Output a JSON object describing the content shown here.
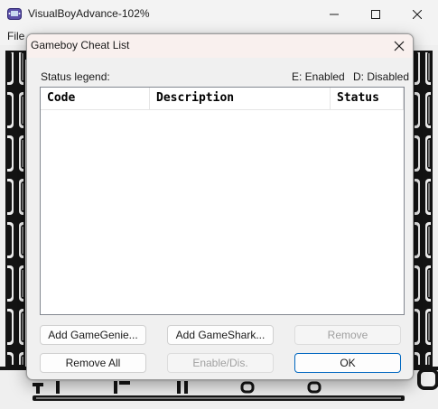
{
  "window": {
    "title": "VisualBoyAdvance-102%",
    "controls": [
      "minimize",
      "maximize",
      "close"
    ]
  },
  "menubar": {
    "items": [
      "File"
    ]
  },
  "dialog": {
    "title": "Gameboy Cheat List",
    "status_legend_label": "Status legend:",
    "legend_enabled": "E: Enabled",
    "legend_disabled": "D: Disabled",
    "columns": [
      "Code",
      "Description",
      "Status"
    ],
    "rows": [],
    "buttons": {
      "add_gamegenie": "Add GameGenie...",
      "add_gameshark": "Add GameShark...",
      "remove": "Remove",
      "remove_all": "Remove All",
      "enable_disable": "Enable/Dis.",
      "ok": "OK"
    },
    "disabled_buttons": [
      "remove",
      "enable_disable"
    ],
    "default_button": "ok"
  },
  "colors": {
    "accent": "#0067c0",
    "screen_dark": "#141414",
    "screen_light": "#efefef"
  }
}
